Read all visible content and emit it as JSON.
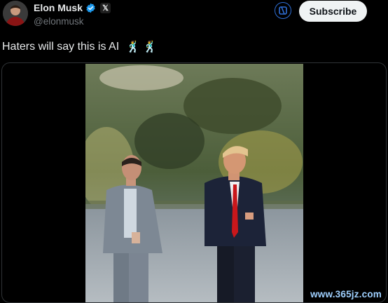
{
  "author": {
    "display_name": "Elon Musk",
    "handle": "@elonmusk",
    "verified_icon": "verified-badge-icon",
    "affiliation_icon": "x-logo-icon",
    "affiliation_glyph": "𝕏"
  },
  "actions": {
    "grok_icon": "grok-icon",
    "subscribe_label": "Subscribe"
  },
  "post": {
    "text": "Haters will say this is AI",
    "emojis": [
      "🕺",
      "🕺"
    ]
  },
  "media": {
    "type": "video",
    "watermark": "www.365jz.com"
  },
  "colors": {
    "background": "#000000",
    "text": "#e7e9ea",
    "secondary_text": "#71767b",
    "verified_blue": "#1d9bf0",
    "subscribe_bg": "#eff3f4"
  }
}
